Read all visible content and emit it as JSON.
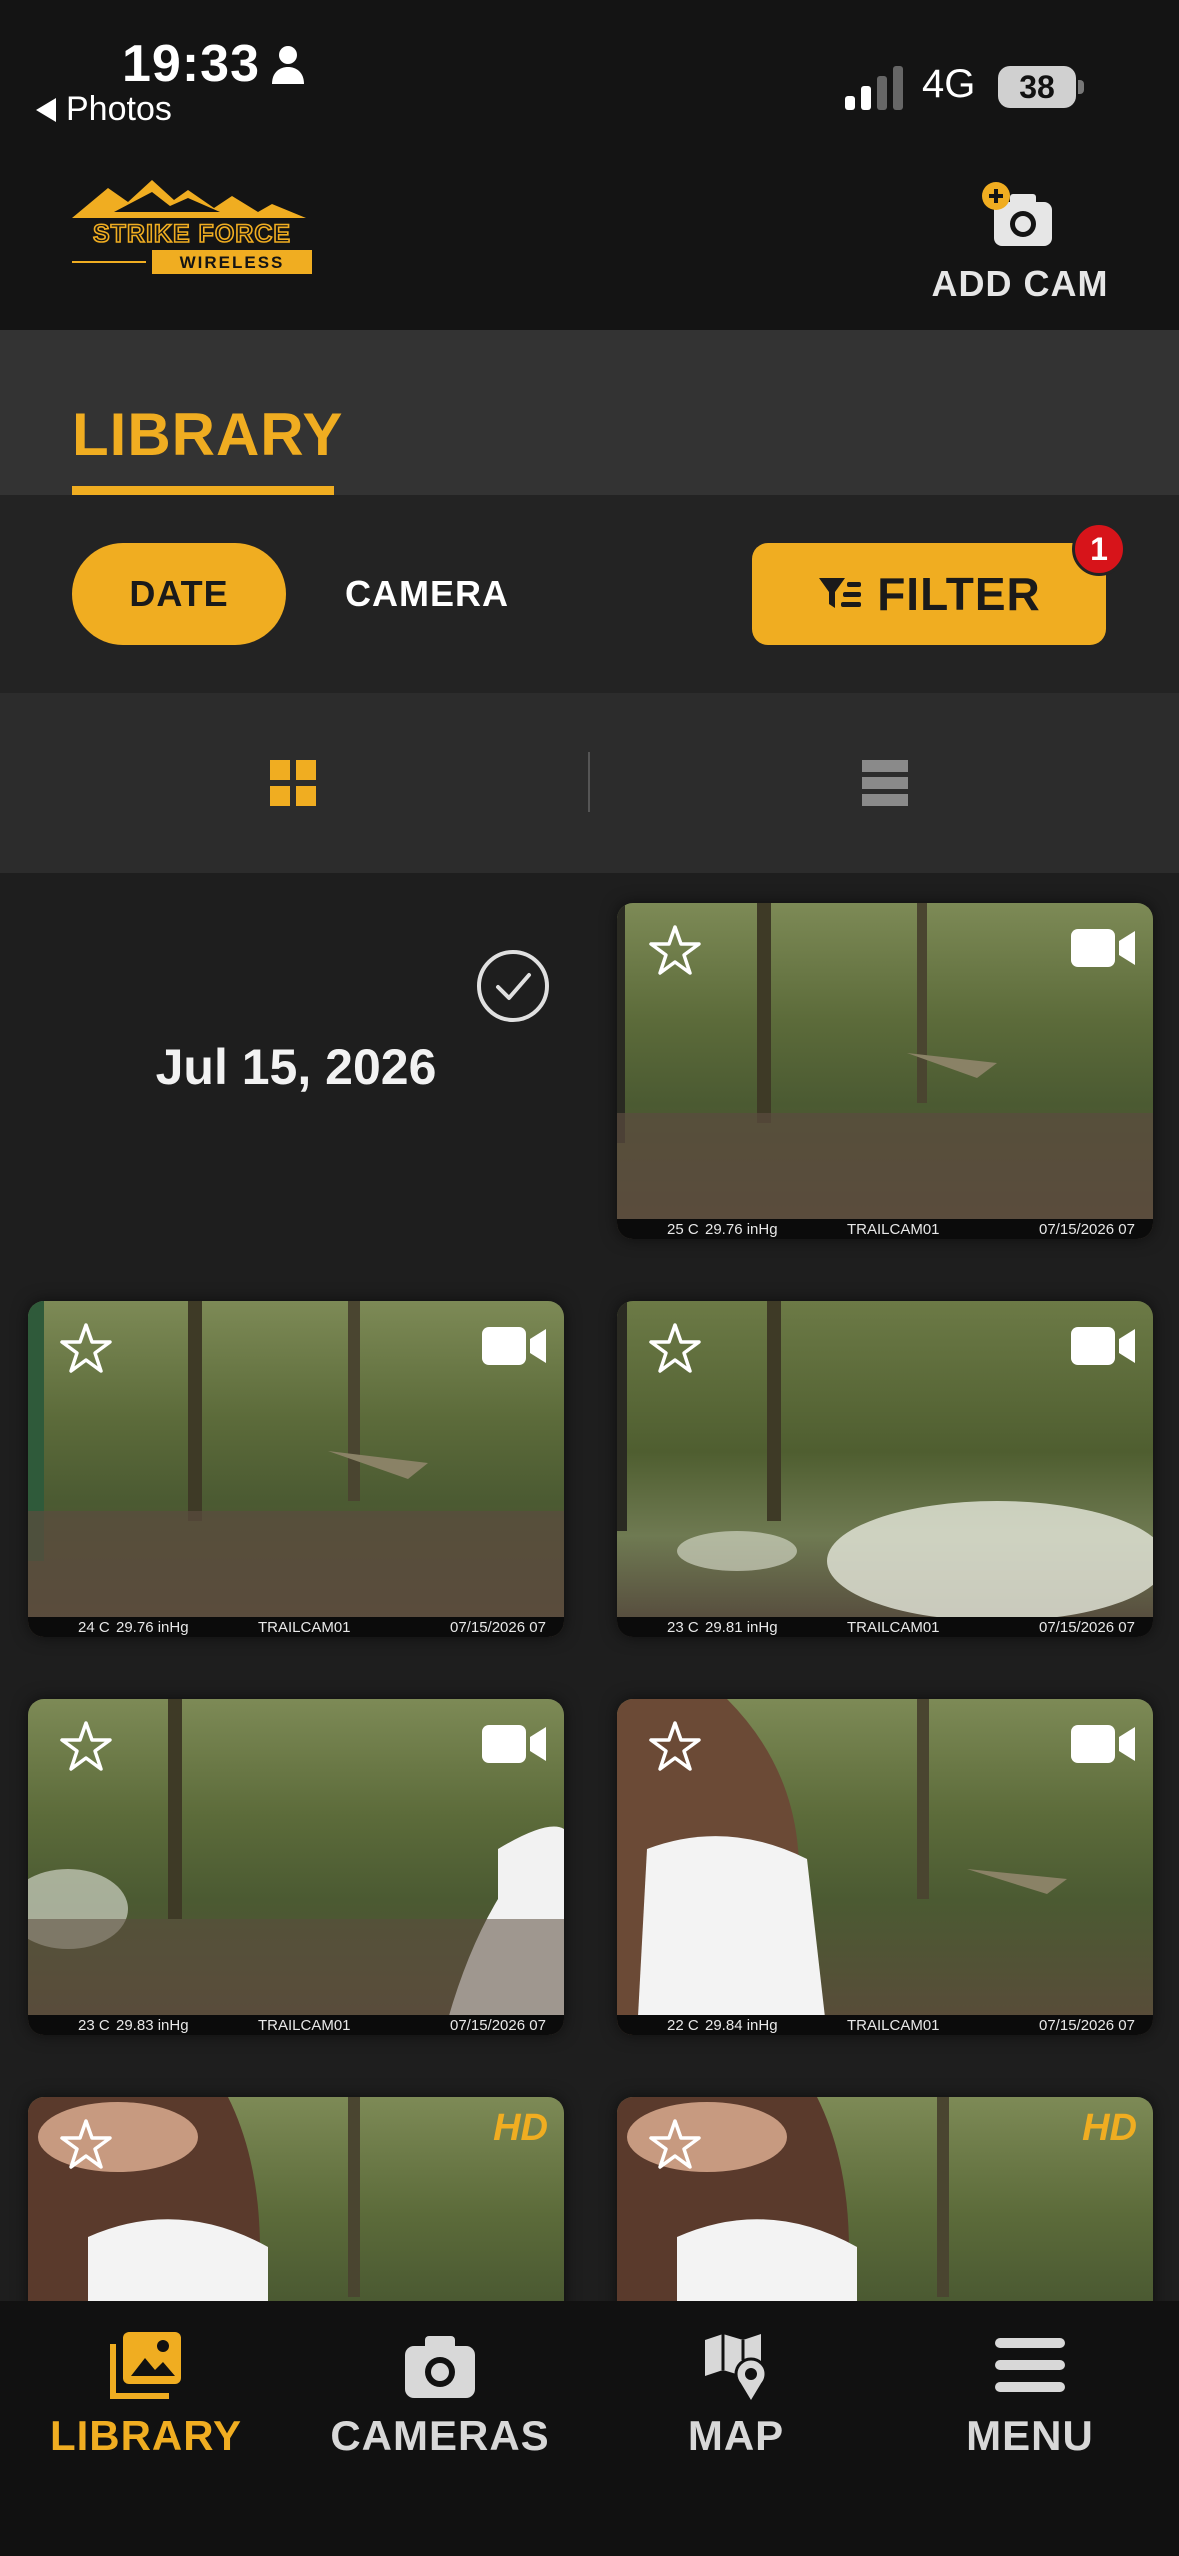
{
  "status_bar": {
    "time": "19:33",
    "back_label": "Photos",
    "network": "4G",
    "battery": "38"
  },
  "header": {
    "logo_line1": "STRIKE FORCE",
    "logo_line2": "WIRELESS",
    "add_cam_label": "ADD CAM"
  },
  "tabs": {
    "active_tab": "LIBRARY"
  },
  "sort": {
    "date_label": "DATE",
    "camera_label": "CAMERA",
    "filter_label": "FILTER",
    "filter_badge": "1"
  },
  "gallery": {
    "date_heading": "Jul 15, 2026",
    "photos": [
      {
        "type": "video",
        "temp": "25 C",
        "pressure": "29.76 inHg",
        "camera": "TRAILCAM01",
        "date": "07/15/2026 07"
      },
      {
        "type": "video",
        "temp": "24 C",
        "pressure": "29.76 inHg",
        "camera": "TRAILCAM01",
        "date": "07/15/2026 07"
      },
      {
        "type": "video",
        "temp": "23 C",
        "pressure": "29.81 inHg",
        "camera": "TRAILCAM01",
        "date": "07/15/2026 07"
      },
      {
        "type": "video",
        "temp": "23 C",
        "pressure": "29.83 inHg",
        "camera": "TRAILCAM01",
        "date": "07/15/2026 07"
      },
      {
        "type": "video",
        "temp": "22 C",
        "pressure": "29.84 inHg",
        "camera": "TRAILCAM01",
        "date": "07/15/2026 07"
      },
      {
        "type": "photo",
        "badge": "HD"
      },
      {
        "type": "photo",
        "badge": "HD"
      }
    ]
  },
  "bottom_nav": {
    "items": [
      {
        "label": "LIBRARY",
        "icon": "photo-library-icon",
        "active": true
      },
      {
        "label": "CAMERAS",
        "icon": "camera-icon",
        "active": false
      },
      {
        "label": "MAP",
        "icon": "map-pin-icon",
        "active": false
      },
      {
        "label": "MENU",
        "icon": "hamburger-menu-icon",
        "active": false
      }
    ]
  },
  "colors": {
    "accent": "#f0ad21",
    "badge_red": "#d7141a",
    "background": "#1e1e1e",
    "header": "#141414"
  }
}
